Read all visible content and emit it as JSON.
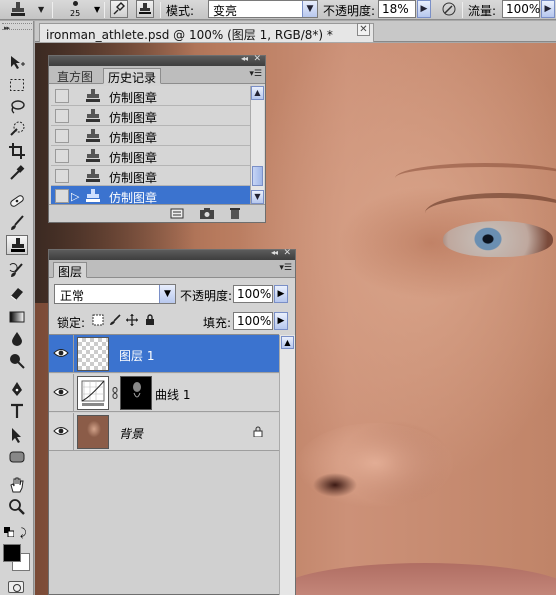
{
  "options_bar": {
    "brush_size": "25",
    "mode_label": "模式:",
    "mode_value": "变亮",
    "opacity_label": "不透明度:",
    "opacity_value": "18%",
    "flow_label": "流量:",
    "flow_value": "100%"
  },
  "document": {
    "tab_title": "ironman_athlete.psd @ 100% (图层 1, RGB/8*) *",
    "close_glyph": "✕"
  },
  "history_panel": {
    "tabs": [
      "直方图",
      "历史记录"
    ],
    "active_tab": 1,
    "items": [
      {
        "label": "仿制图章",
        "selected": false
      },
      {
        "label": "仿制图章",
        "selected": false
      },
      {
        "label": "仿制图章",
        "selected": false
      },
      {
        "label": "仿制图章",
        "selected": false
      },
      {
        "label": "仿制图章",
        "selected": false
      },
      {
        "label": "仿制图章",
        "selected": true
      }
    ],
    "footer_icons": [
      "new-document-from-state-icon",
      "camera-snapshot-icon",
      "trash-icon"
    ]
  },
  "layers_panel": {
    "tab": "图层",
    "blend_mode": "正常",
    "opacity_label": "不透明度:",
    "opacity_value": "100%",
    "lock_label": "锁定:",
    "fill_label": "填充:",
    "fill_value": "100%",
    "layers": [
      {
        "name": "图层 1",
        "thumb": "transparent",
        "visible": true,
        "selected": true
      },
      {
        "name": "曲线 1",
        "thumb": "curves",
        "has_mask": true,
        "visible": true,
        "selected": false
      },
      {
        "name": "背景",
        "thumb": "photo",
        "locked": true,
        "visible": true,
        "selected": false
      }
    ]
  },
  "toolbox": {
    "tools": [
      "move-tool",
      "marquee-tool",
      "lasso-tool",
      "quick-selection-tool",
      "crop-tool",
      "eyedropper-tool",
      "healing-brush-tool",
      "brush-tool",
      "clone-stamp-tool",
      "history-brush-tool",
      "eraser-tool",
      "gradient-tool",
      "blur-tool",
      "dodge-tool",
      "pen-tool",
      "type-tool",
      "path-selection-tool",
      "shape-tool",
      "hand-tool",
      "zoom-tool"
    ],
    "active_tool": "clone-stamp-tool",
    "foreground_color": "#000000",
    "background_color": "#ffffff"
  },
  "colors": {
    "selection_blue": "#3b73cf",
    "panel_gray": "#d4d4d4"
  }
}
